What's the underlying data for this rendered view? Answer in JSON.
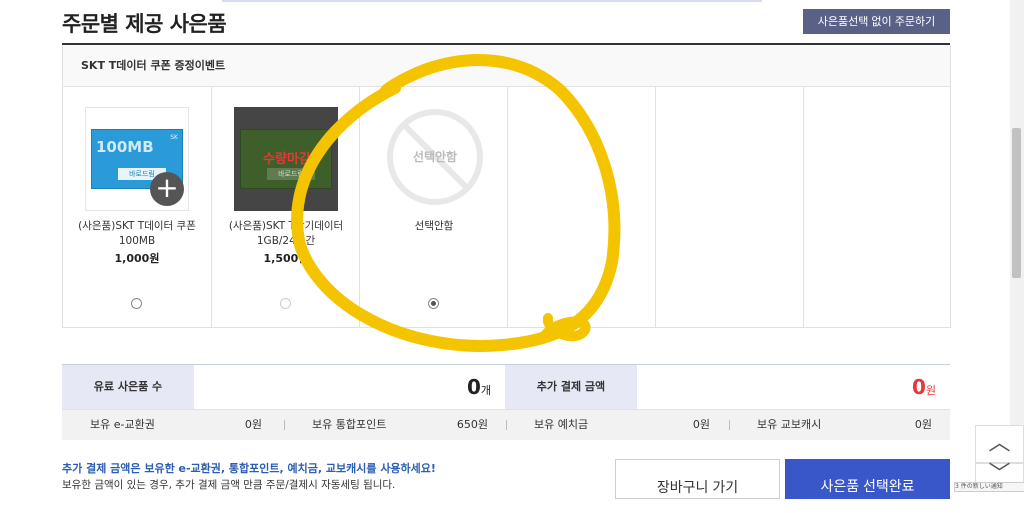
{
  "header": {
    "title": "주문별 제공 사은품",
    "no_gift_button": "사은품선택 없이 주문하기"
  },
  "event": {
    "title": "SKT T데이터 쿠폰 증정이벤트",
    "items": [
      {
        "name": "(사은품)SKT T데이터 쿠폰 100MB",
        "price": "1,000원",
        "card_text": "100MB",
        "badge": "바로드림",
        "selected": false,
        "sold_out": false
      },
      {
        "name": "(사은품)SKT T단기데이터 1GB/24시간",
        "price": "1,500원",
        "card_text": "",
        "badge": "바로드림",
        "sold_out_label": "수량마감",
        "selected": false,
        "sold_out": true
      },
      {
        "name": "선택안함",
        "price": "",
        "icon_label": "선택안함",
        "selected": true
      }
    ]
  },
  "summary": {
    "paid_gift_count_label": "유료 사은품 수",
    "paid_gift_count_value": "0",
    "paid_gift_count_unit": "개",
    "extra_payment_label": "추가 결제 금액",
    "extra_payment_value": "0",
    "extra_payment_unit": "원"
  },
  "balances": [
    {
      "label": "보유 e-교환권",
      "value": "0원"
    },
    {
      "label": "보유 통합포인트",
      "value": "650원"
    },
    {
      "label": "보유 예치금",
      "value": "0원"
    },
    {
      "label": "보유 교보캐시",
      "value": "0원"
    }
  ],
  "notice": {
    "line1": "추가 결제 금액은 보유한 e-교환권, 통합포인트, 예치금, 교보캐시를 사용하세요!",
    "line2": "보유한 금액이 있는 경우, 추가 결제 금액 만큼 주문/결제시 자동세팅 됩니다."
  },
  "buttons": {
    "cart": "장바구니 가기",
    "complete": "사은품 선택완료"
  },
  "side": {
    "up": "︿",
    "down": "﹀",
    "tip": "3 件の新しい通知"
  },
  "colors": {
    "accent": "#3a57c9",
    "annotation": "#f5c400",
    "highlight_red": "#e53838"
  }
}
